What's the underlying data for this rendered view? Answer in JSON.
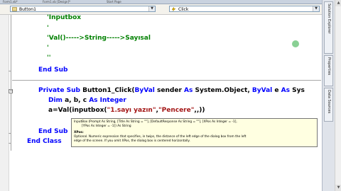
{
  "tabs": [
    "Form1.vb*",
    "Form1.vb [Design]*",
    "Start Page"
  ],
  "toolbar": {
    "object_combo": "Button1",
    "event_combo": "Click"
  },
  "code_lines": {
    "l1": "'Inputbox",
    "l2": "'",
    "l3": "'Val()----->String----->Sayısal",
    "l4": "'",
    "l5": "''",
    "end_sub_1": "End Sub",
    "private": "Private",
    "sub": "Sub",
    "sub_name": "Button1_Click(",
    "byval1": "ByVal",
    "sender": "sender",
    "as1": "As",
    "sysobj": "System.Object,",
    "byval2": "ByVal",
    "e": "e",
    "as2": "As",
    "sys_tail": "Sys",
    "dim": "Dim",
    "dim_vars": "a, b, c",
    "as3": "As",
    "integer": "Integer",
    "assign": "a=Val(inputbox(",
    "str1": "\"1.sayı yazın\"",
    "comma": ",",
    "str2": "\"Pencere\"",
    "tail": ",,))",
    "end_sub_2": "End Sub",
    "end_class": "End Class"
  },
  "tooltip": {
    "signature": "InputBox (Prompt As String, [Title As String = \"\"], [DefaultResponse As String = \"\"], [XPos As Integer = -1],",
    "signature2": "        [YPos As Integer = -1]) As String",
    "param_label": "XPos:",
    "desc1": "Optional. Numeric expression that specifies, in twips, the distance of the left edge of the dialog box from the left",
    "desc2": "edge of the screen. If you omit XPos, the dialog box is centered horizontally."
  },
  "right_panel": [
    "Solution Explorer",
    "Properties",
    "Data Sources"
  ],
  "colors": {
    "keyword": "#0000ff",
    "comment": "#008000",
    "string": "#a31515"
  }
}
